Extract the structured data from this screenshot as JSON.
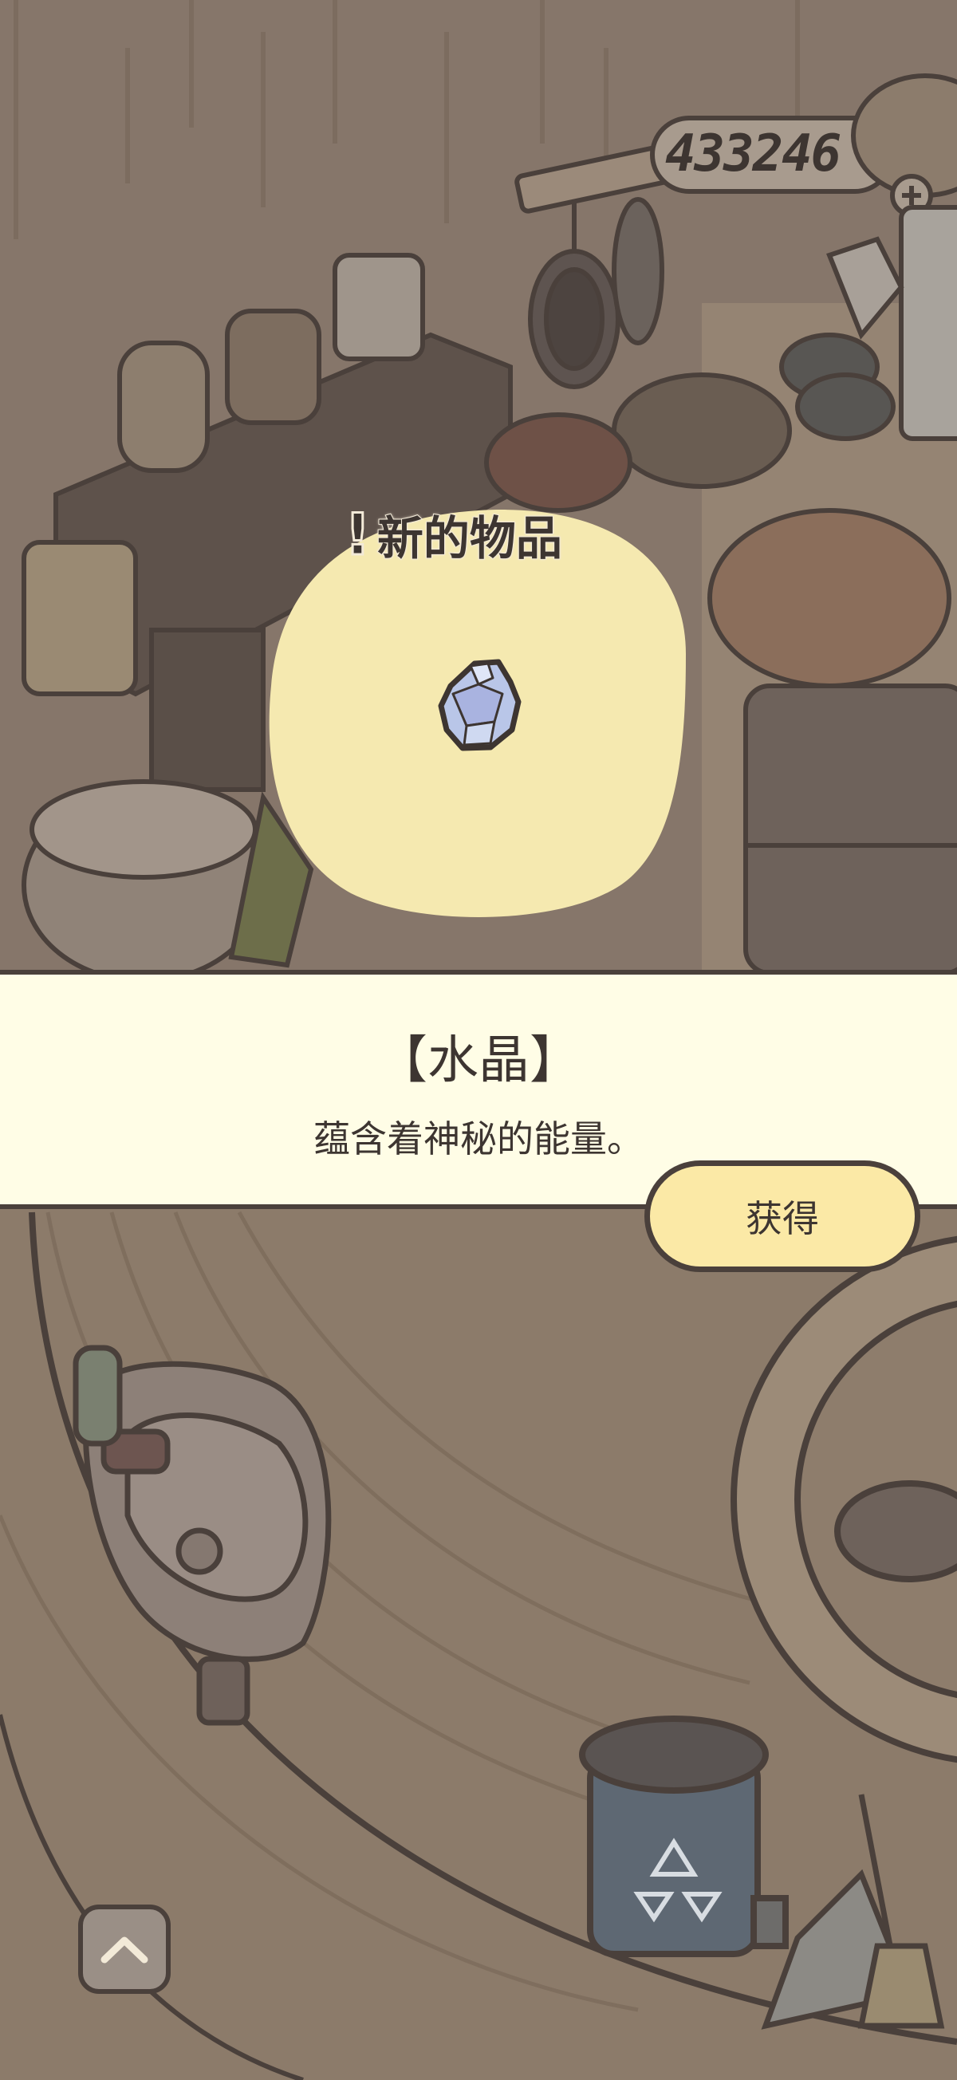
{
  "hud": {
    "coin_count": "433246",
    "plus_icon": "plus-icon"
  },
  "popup": {
    "header": "新的物品",
    "header_icon": "exclamation-icon",
    "item_icon": "crystal-icon",
    "item_name": "【水晶】",
    "item_description": "蕴含着神秘的能量。",
    "obtain_label": "获得"
  },
  "controls": {
    "expand_icon": "chevron-up-icon"
  },
  "colors": {
    "panel_bg": "#fffde6",
    "button_bg": "#fbe9a6",
    "spotlight": "#f5e9b0",
    "outline": "#4a403b",
    "dim_bg": "#8b7b6c"
  }
}
